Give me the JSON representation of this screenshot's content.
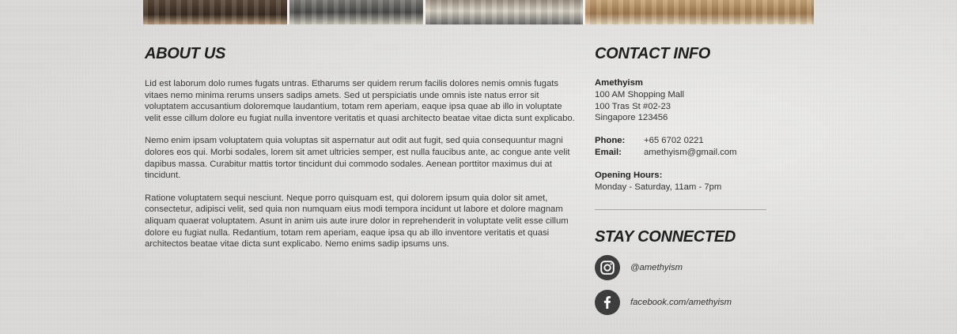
{
  "about": {
    "title": "ABOUT US",
    "paragraphs": [
      "Lid est laborum dolo rumes fugats untras. Etharums ser quidem rerum facilis dolores nemis omnis fugats vitaes nemo minima rerums unsers sadips amets. Sed ut perspiciatis unde omnis iste natus error sit voluptatem accusantium doloremque laudantium, totam rem aperiam, eaque ipsa quae ab illo in voluptate velit esse cillum dolore eu fugiat nulla inventore veritatis et quasi architecto beatae vitae dicta sunt explicabo.",
      "Nemo enim ipsam voluptatem quia voluptas sit aspernatur aut odit aut fugit, sed quia consequuntur magni dolores eos qui. Morbi sodales, lorem sit amet ultricies semper, est nulla faucibus ante, ac congue ante velit dapibus massa. Curabitur mattis tortor tincidunt dui commodo sodales. Aenean porttitor maximus dui at tincidunt.",
      "Ratione voluptatem sequi nesciunt. Neque porro quisquam est, qui dolorem ipsum quia dolor sit amet, consectetur, adipisci velit, sed quia non numquam eius modi tempora incidunt ut labore et dolore magnam aliquam quaerat voluptatem. Asunt in anim uis aute irure dolor in reprehenderit in voluptate velit esse cillum dolore eu fugiat nulla. Redantium, totam rem aperiam, eaque ipsa qu ab illo inventore veritatis et quasi architectos beatae vitae dicta sunt explicabo. Nemo enims sadip ipsums uns."
    ]
  },
  "contact": {
    "title": "CONTACT INFO",
    "business_name": "Amethyism",
    "address_lines": [
      "100 AM Shopping Mall",
      "100 Tras St #02-23",
      "Singapore 123456"
    ],
    "phone_label": "Phone:",
    "phone": "+65 6702 0221",
    "email_label": "Email:",
    "email": "amethyism@gmail.com",
    "hours_label": "Opening Hours:",
    "hours": "Monday - Saturday, 11am - 7pm"
  },
  "connected": {
    "title": "STAY CONNECTED",
    "instagram": {
      "icon": "instagram-icon",
      "handle": "@amethyism"
    },
    "facebook": {
      "icon": "facebook-icon",
      "handle": "facebook.com/amethyism"
    }
  },
  "colors": {
    "background": "#e2e1df",
    "text": "#3a3a3a",
    "heading": "#1f1f1f",
    "icon_bg": "#3d3d3d",
    "divider": "#a9a7a3"
  }
}
